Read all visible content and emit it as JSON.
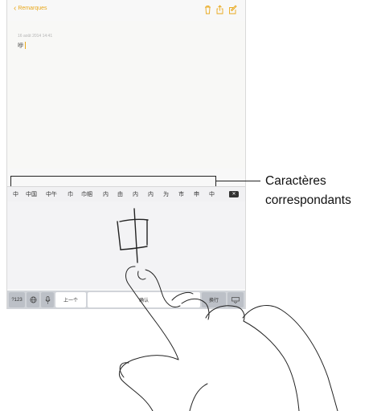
{
  "navbar": {
    "back_label": "Remarques"
  },
  "note": {
    "date": "16 août 2014 14:41",
    "text": "咿"
  },
  "candidates": [
    "中",
    "中国",
    "中午",
    "巾",
    "巾帼",
    "内",
    "由",
    "内",
    "内",
    "为",
    "市",
    "申",
    "中"
  ],
  "keyboard": {
    "numbers_key": "?123",
    "prev_key": "上一个",
    "confirm_key": "确认",
    "return_key": "换行"
  },
  "callout": {
    "line1": "Caractères",
    "line2": "correspondants"
  },
  "icons": {
    "back": "chevron-left-icon",
    "trash": "trash-icon",
    "share": "share-icon",
    "compose": "compose-icon",
    "globe": "globe-icon",
    "mic": "microphone-icon",
    "delete": "delete-icon",
    "hide": "keyboard-hide-icon"
  },
  "colors": {
    "accent": "#e9a81b",
    "keyboard_bg": "#d1d4d9"
  }
}
